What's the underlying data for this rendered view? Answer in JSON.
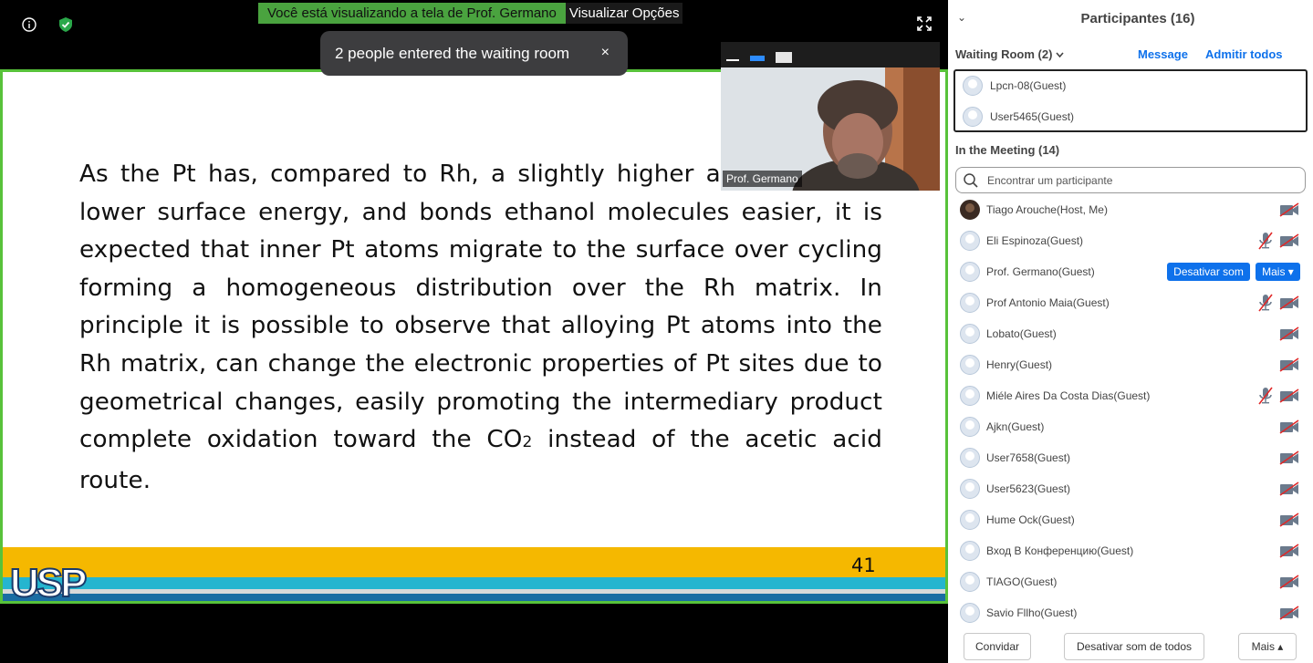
{
  "stage": {
    "share_banner": "Você está visualizando a tela de Prof. Germano",
    "share_options": "Visualizar Opções",
    "toast": {
      "message": "2 people entered the waiting room",
      "close": "×"
    },
    "video": {
      "name": "Prof. Germano"
    },
    "colors": {
      "frame_border": "#58c23a",
      "toast_bg": "#3d3d3f",
      "banner_bg": "#4aa33f"
    }
  },
  "slide": {
    "text_before_sub": "As the Pt has, compared to Rh, a slightly higher atomic radius, lower surface energy, and bonds ethanol molecules easier, it is expected that inner Pt atoms migrate to the surface over cycling forming a homogeneous distribution over the Rh matrix. In principle it is possible to observe that alloying Pt atoms into the Rh matrix, can change the electronic properties of Pt sites due to geometrical changes, easily promoting the intermediary product complete oxidation toward the CO",
    "subscript": "2",
    "text_after_sub": " instead of the acetic acid route.",
    "page_number": "41",
    "logo": "USP",
    "colors": {
      "orange": "#f5b800",
      "cyan": "#25b5cf",
      "blue": "#1a6da3"
    }
  },
  "panel": {
    "title": "Participantes (16)",
    "chevron": "⌄",
    "waiting": {
      "label": "Waiting Room (2)",
      "message_link": "Message",
      "admit_all": "Admitir todos",
      "people": [
        "Lpcn-08(Guest)",
        "User5465(Guest)"
      ]
    },
    "meeting_label": "In the Meeting (14)",
    "search_placeholder": "Encontrar um participante",
    "participants": [
      {
        "name": "Tiago Arouche(Host, Me)",
        "host": true,
        "mic_off": false,
        "cam_off": true,
        "buttons": false
      },
      {
        "name": "Eli Espinoza(Guest)",
        "host": false,
        "mic_off": true,
        "cam_off": true,
        "buttons": false
      },
      {
        "name": "Prof. Germano(Guest)",
        "host": false,
        "mic_off": false,
        "cam_off": false,
        "buttons": true
      },
      {
        "name": "Prof Antonio Maia(Guest)",
        "host": false,
        "mic_off": true,
        "cam_off": true,
        "buttons": false
      },
      {
        "name": "Lobato(Guest)",
        "host": false,
        "mic_off": false,
        "cam_off": true,
        "buttons": false
      },
      {
        "name": "Henry(Guest)",
        "host": false,
        "mic_off": false,
        "cam_off": true,
        "buttons": false
      },
      {
        "name": "Miéle Aires Da Costa Dias(Guest)",
        "host": false,
        "mic_off": true,
        "cam_off": true,
        "buttons": false
      },
      {
        "name": "Ajkn(Guest)",
        "host": false,
        "mic_off": false,
        "cam_off": true,
        "buttons": false
      },
      {
        "name": "User7658(Guest)",
        "host": false,
        "mic_off": false,
        "cam_off": true,
        "buttons": false
      },
      {
        "name": "User5623(Guest)",
        "host": false,
        "mic_off": false,
        "cam_off": true,
        "buttons": false
      },
      {
        "name": "Hume Ock(Guest)",
        "host": false,
        "mic_off": false,
        "cam_off": true,
        "buttons": false
      },
      {
        "name": "Вход В Конференцию(Guest)",
        "host": false,
        "mic_off": false,
        "cam_off": true,
        "buttons": false
      },
      {
        "name": "TIAGO(Guest)",
        "host": false,
        "mic_off": false,
        "cam_off": true,
        "buttons": false
      },
      {
        "name": "Savio Fllho(Guest)",
        "host": false,
        "mic_off": false,
        "cam_off": true,
        "buttons": false
      }
    ],
    "row_buttons": {
      "mute": "Desativar som",
      "more": "Mais ▾"
    },
    "footer": {
      "invite": "Convidar",
      "mute_all": "Desativar som de todos",
      "more": "Mais ▴"
    },
    "colors": {
      "accent": "#0e71eb",
      "red_slash": "#e02828"
    }
  }
}
